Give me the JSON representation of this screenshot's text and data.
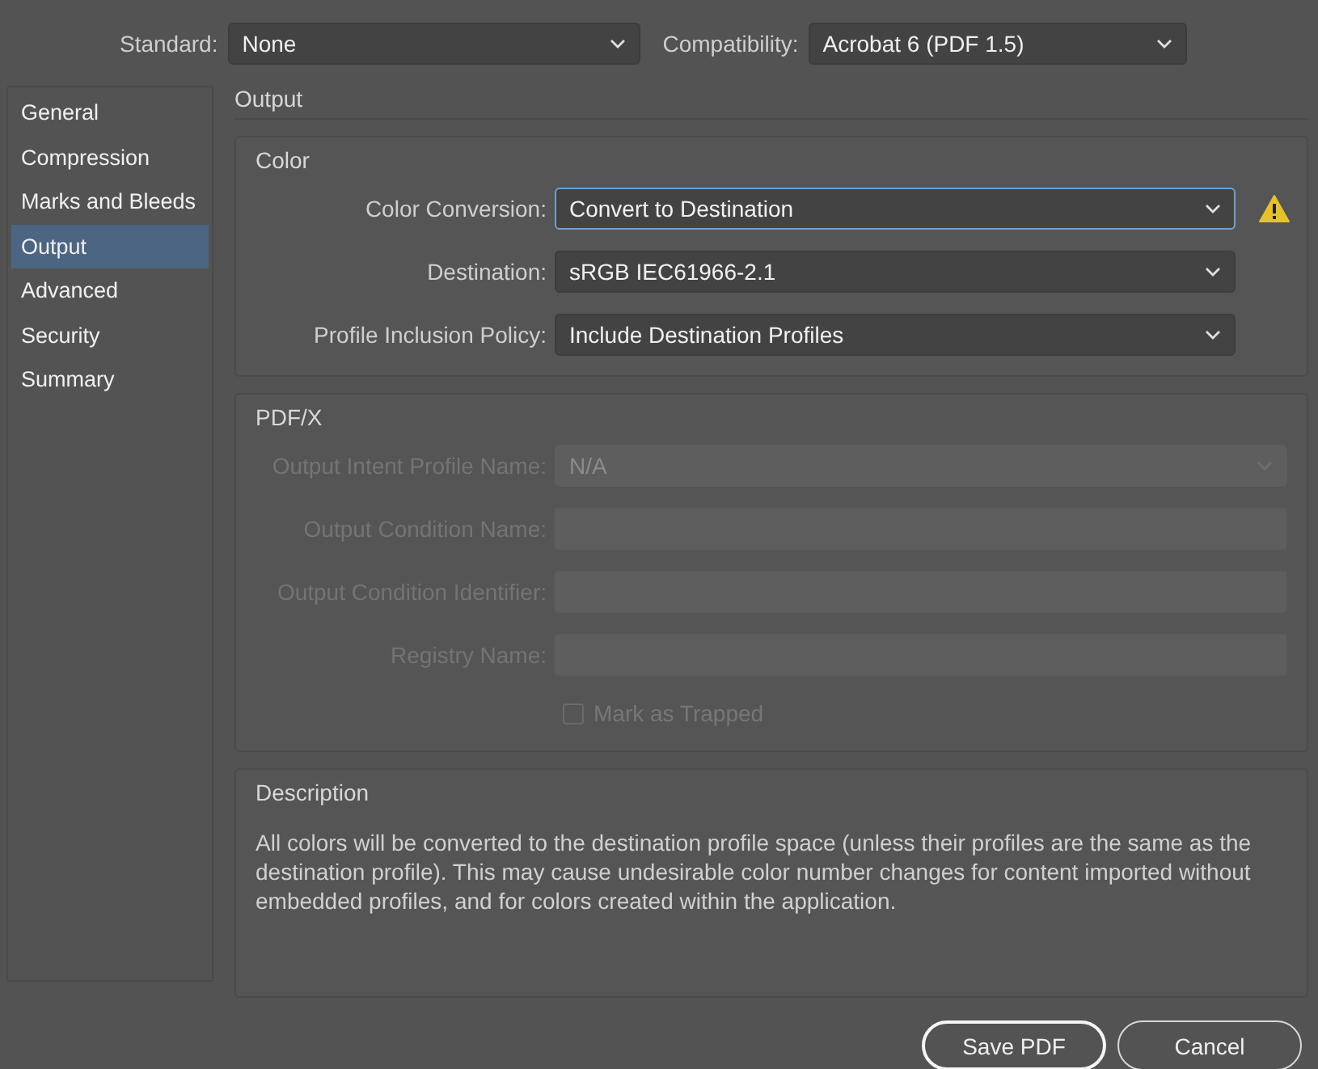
{
  "header": [
    {
      "label": "Standard:",
      "value": "None"
    },
    {
      "label": "Compatibility:",
      "value": "Acrobat 6 (PDF 1.5)"
    }
  ],
  "sidebar": {
    "items": [
      {
        "label": "General",
        "selected": false
      },
      {
        "label": "Compression",
        "selected": false
      },
      {
        "label": "Marks and Bleeds",
        "selected": false
      },
      {
        "label": "Output",
        "selected": true
      },
      {
        "label": "Advanced",
        "selected": false
      },
      {
        "label": "Security",
        "selected": false
      },
      {
        "label": "Summary",
        "selected": false
      }
    ]
  },
  "panel": {
    "title": "Output",
    "color": {
      "title": "Color",
      "fields": [
        {
          "label": "Color Conversion:",
          "kind": "dropdown",
          "value": "Convert to Destination",
          "focused": true,
          "warning": true
        },
        {
          "label": "Destination:",
          "kind": "dropdown",
          "value": "sRGB IEC61966-2.1",
          "focused": false,
          "warning": false
        },
        {
          "label": "Profile Inclusion Policy:",
          "kind": "dropdown",
          "value": "Include Destination Profiles",
          "focused": false,
          "warning": false
        }
      ]
    },
    "pdfx": {
      "title": "PDF/X",
      "disabled": true,
      "fields": [
        {
          "label": "Output Intent Profile Name:",
          "kind": "dropdown",
          "value": "N/A"
        },
        {
          "label": "Output Condition Name:",
          "kind": "text"
        },
        {
          "label": "Output Condition Identifier:",
          "kind": "text"
        },
        {
          "label": "Registry Name:",
          "kind": "text"
        }
      ],
      "checkbox": {
        "label": "Mark as Trapped",
        "checked": false
      }
    },
    "description": {
      "title": "Description",
      "text": "All colors will be converted to the destination profile space (unless their profiles are the same as the destination profile). This may cause undesirable color number changes for content imported without embedded profiles, and for colors created within the application."
    }
  },
  "buttons": [
    {
      "label": "Save PDF",
      "default": true
    },
    {
      "label": "Cancel",
      "default": false
    }
  ]
}
